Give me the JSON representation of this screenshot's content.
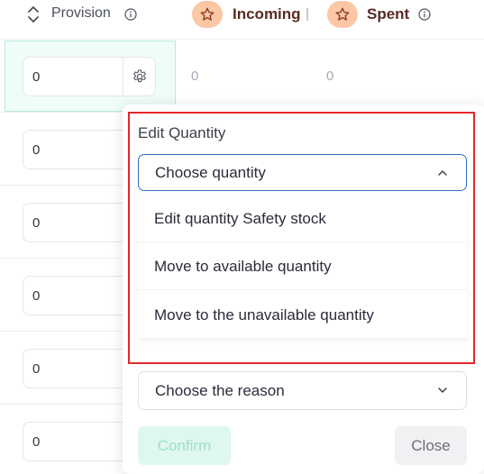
{
  "header": {
    "provision_label": "Provision",
    "incoming_label": "Incoming",
    "spent_label": "Spent"
  },
  "rows": [
    {
      "provision": "0",
      "incoming": "0",
      "spent": "0"
    },
    {
      "provision": "0"
    },
    {
      "provision": "0"
    },
    {
      "provision": "0"
    },
    {
      "provision": "0"
    },
    {
      "provision": "0"
    }
  ],
  "popover": {
    "title": "Edit Quantity",
    "quantity_select": {
      "value": "Choose quantity",
      "options": [
        "Edit quantity Safety stock",
        "Move to available quantity",
        "Move to the unavailable quantity"
      ]
    },
    "reason_select": {
      "value": "Choose the reason"
    },
    "confirm_label": "Confirm",
    "close_label": "Close"
  },
  "colors": {
    "accent_blue": "#2f6fc4",
    "selected_cell_bg": "#eefdf8",
    "confirm_disabled_bg": "#dff8ef",
    "star_badge": "#fbc7a5",
    "highlight_red": "#e3262b"
  }
}
